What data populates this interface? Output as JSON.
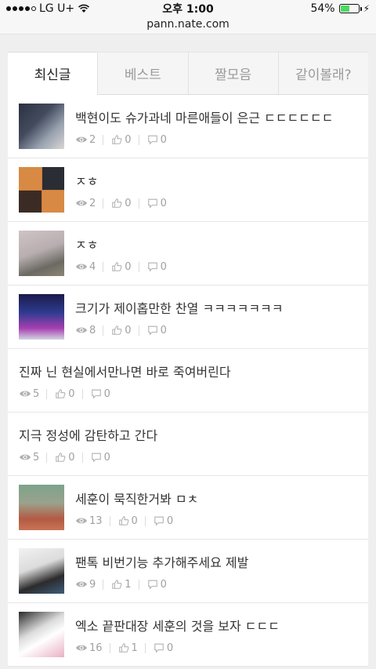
{
  "status_bar": {
    "carrier": "LG U+",
    "time": "오후 1:00",
    "battery": "54%",
    "battery_level": 0.54,
    "signal_bars_filled": 4,
    "signal_bars_total": 5
  },
  "url_bar": {
    "url": "pann.nate.com"
  },
  "tabs": [
    {
      "label": "최신글",
      "active": true
    },
    {
      "label": "베스트",
      "active": false
    },
    {
      "label": "짤모음",
      "active": false
    },
    {
      "label": "같이볼래?",
      "active": false
    }
  ],
  "posts": [
    {
      "title": "백현이도 슈가과네 마른애들이 은근 ㄷㄷㄷㄷㄷㄷ",
      "views": "2",
      "likes": "0",
      "comments": "0",
      "thumb": true
    },
    {
      "title": "ㅈㅎ",
      "views": "2",
      "likes": "0",
      "comments": "0",
      "thumb": true
    },
    {
      "title": "ㅈㅎ",
      "views": "4",
      "likes": "0",
      "comments": "0",
      "thumb": true
    },
    {
      "title": "크기가 제이홉만한 찬열 ㅋㅋㅋㅋㅋㅋㅋ",
      "views": "8",
      "likes": "0",
      "comments": "0",
      "thumb": true
    },
    {
      "title": "진짜 닌 현실에서만나면 바로 죽여버린다",
      "views": "5",
      "likes": "0",
      "comments": "0",
      "thumb": false
    },
    {
      "title": "지극 정성에 감탄하고 간다",
      "views": "5",
      "likes": "0",
      "comments": "0",
      "thumb": false
    },
    {
      "title": "세훈이 묵직한거봐 ㅁㅊ",
      "views": "13",
      "likes": "0",
      "comments": "0",
      "thumb": true
    },
    {
      "title": "팬톡 비번기능 추가해주세요 제발",
      "views": "9",
      "likes": "1",
      "comments": "0",
      "thumb": true
    },
    {
      "title": "엑소 끝판대장 세훈의 것을 보자 ㄷㄷㄷ",
      "views": "16",
      "likes": "1",
      "comments": "0",
      "thumb": true
    }
  ]
}
